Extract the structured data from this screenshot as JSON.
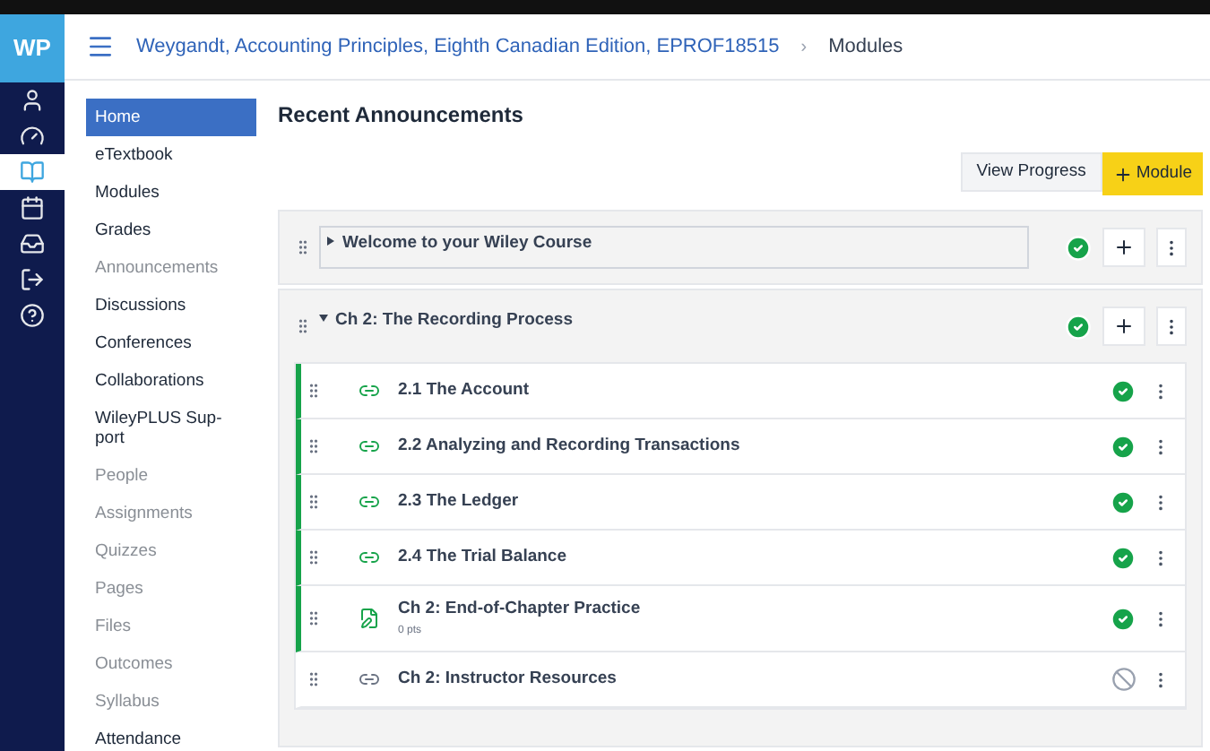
{
  "logo": "WP",
  "rail": [
    {
      "selected": false
    },
    {
      "selected": false
    },
    {
      "selected": true
    },
    {
      "selected": false
    },
    {
      "selected": false
    },
    {
      "selected": false
    },
    {
      "selected": false
    }
  ],
  "breadcrumb": {
    "course": "Weygandt, Accounting Principles, Eighth Canadian Edition, EPROF18515",
    "separator": "›",
    "page": "Modules"
  },
  "nav": [
    {
      "label": "Home",
      "selected": true,
      "disabled": false
    },
    {
      "label": "eTextbook",
      "selected": false,
      "disabled": false
    },
    {
      "label": "Modules",
      "selected": false,
      "disabled": false
    },
    {
      "label": "Grades",
      "selected": false,
      "disabled": false
    },
    {
      "label": "Announcements",
      "selected": false,
      "disabled": true
    },
    {
      "label": "Discussions",
      "selected": false,
      "disabled": false
    },
    {
      "label": "Conferences",
      "selected": false,
      "disabled": false
    },
    {
      "label": "Collaborations",
      "selected": false,
      "disabled": false
    },
    {
      "label": "WileyPLUS Sup-port",
      "selected": false,
      "disabled": false
    },
    {
      "label": "People",
      "selected": false,
      "disabled": true
    },
    {
      "label": "Assignments",
      "selected": false,
      "disabled": true
    },
    {
      "label": "Quizzes",
      "selected": false,
      "disabled": true
    },
    {
      "label": "Pages",
      "selected": false,
      "disabled": true
    },
    {
      "label": "Files",
      "selected": false,
      "disabled": true
    },
    {
      "label": "Outcomes",
      "selected": false,
      "disabled": true
    },
    {
      "label": "Syllabus",
      "selected": false,
      "disabled": true
    },
    {
      "label": "Attendance",
      "selected": false,
      "disabled": false
    }
  ],
  "heading": "Recent Announcements",
  "buttons": {
    "view_progress": "View Progress",
    "add_module": "Module"
  },
  "modules": [
    {
      "title": "Welcome to your Wiley Course",
      "expanded": false,
      "published": true
    },
    {
      "title": "Ch 2: The Recording Process",
      "expanded": true,
      "published": true,
      "items": [
        {
          "kind": "link",
          "title": "2.1 The Account",
          "published": true
        },
        {
          "kind": "link",
          "title": "2.2 Analyzing and Recording Transactions",
          "published": true
        },
        {
          "kind": "link",
          "title": "2.3 The Ledger",
          "published": true
        },
        {
          "kind": "link",
          "title": "2.4 The Trial Balance",
          "published": true
        },
        {
          "kind": "assignment",
          "title": "Ch 2: End-of-Chapter Practice",
          "sub": "0 pts",
          "published": true
        },
        {
          "kind": "link",
          "title": "Ch 2: Instructor Resources",
          "published": false
        }
      ]
    }
  ]
}
